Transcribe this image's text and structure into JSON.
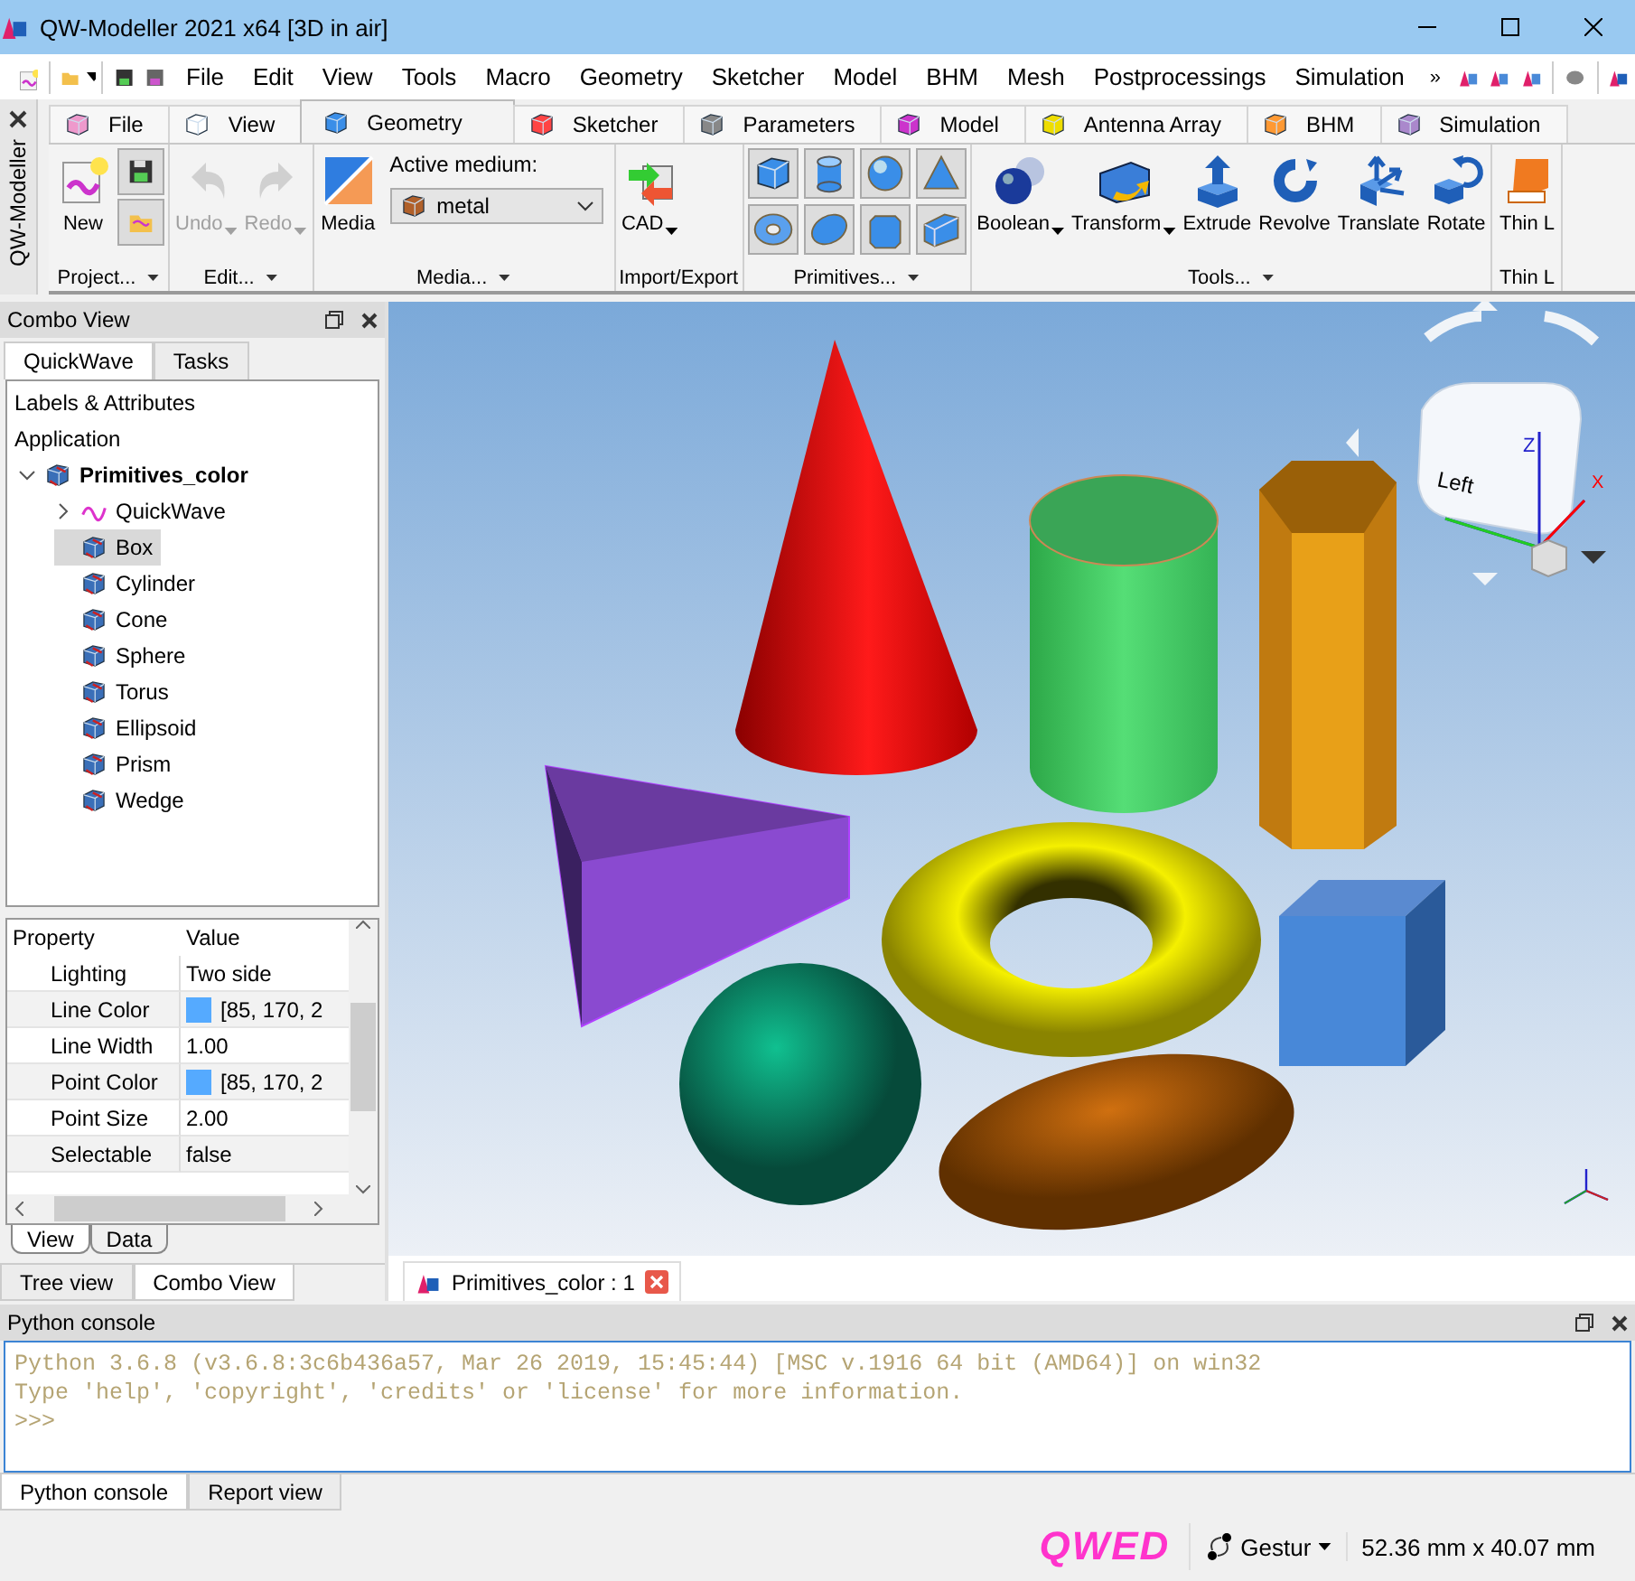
{
  "window": {
    "title": "QW-Modeller 2021 x64 [3D in air]"
  },
  "menu": [
    {
      "label": "File"
    },
    {
      "label": "Edit"
    },
    {
      "label": "View"
    },
    {
      "label": "Tools"
    },
    {
      "label": "Macro"
    },
    {
      "label": "Geometry"
    },
    {
      "label": "Sketcher"
    },
    {
      "label": "Model"
    },
    {
      "label": "BHM"
    },
    {
      "label": "Mesh"
    },
    {
      "label": "Postprocessings"
    },
    {
      "label": "Simulation"
    }
  ],
  "menu_overflow": "»",
  "side_strip": {
    "title": "QW-Modeller"
  },
  "ribbon_tabs": [
    {
      "label": "File",
      "selected": false
    },
    {
      "label": "View",
      "selected": false
    },
    {
      "label": "Geometry",
      "selected": true
    },
    {
      "label": "Sketcher",
      "selected": false
    },
    {
      "label": "Parameters",
      "selected": false
    },
    {
      "label": "Model",
      "selected": false
    },
    {
      "label": "Antenna Array",
      "selected": false
    },
    {
      "label": "BHM",
      "selected": false
    },
    {
      "label": "Simulation",
      "selected": false
    }
  ],
  "ribbon_groups": [
    {
      "title": "Project...",
      "launcher": true,
      "buttons": [
        {
          "kind": "large",
          "label": "New",
          "disabled": false,
          "menu": false
        },
        {
          "kind": "stack"
        }
      ]
    },
    {
      "title": "Edit...",
      "launcher": true,
      "buttons": [
        {
          "kind": "large",
          "label": "Undo",
          "disabled": true,
          "menu": true
        },
        {
          "kind": "large",
          "label": "Redo",
          "disabled": true,
          "menu": true
        }
      ]
    },
    {
      "title": "Media...",
      "launcher": true,
      "buttons": [
        {
          "kind": "large",
          "label": "Media",
          "disabled": false,
          "menu": false
        },
        {
          "kind": "field",
          "caption": "Active medium:",
          "value": "metal"
        }
      ]
    },
    {
      "title": "Import/Export",
      "launcher": false,
      "buttons": [
        {
          "kind": "large",
          "label": "CAD",
          "disabled": false,
          "menu": true
        }
      ]
    },
    {
      "title": "Primitives...",
      "launcher": true,
      "buttons": [
        {
          "kind": "grid"
        }
      ]
    },
    {
      "title": "Tools...",
      "launcher": true,
      "buttons": [
        {
          "kind": "large",
          "label": "Boolean",
          "disabled": false,
          "menu": true
        },
        {
          "kind": "large",
          "label": "Transform",
          "disabled": false,
          "menu": true
        },
        {
          "kind": "large",
          "label": "Extrude",
          "disabled": false,
          "menu": false
        },
        {
          "kind": "large",
          "label": "Revolve",
          "disabled": false,
          "menu": false
        },
        {
          "kind": "large",
          "label": "Translate",
          "disabled": false,
          "menu": false
        },
        {
          "kind": "large",
          "label": "Rotate",
          "disabled": false,
          "menu": false
        }
      ]
    },
    {
      "title": "Thin L",
      "launcher": false,
      "buttons": [
        {
          "kind": "large",
          "label": "Thin L",
          "disabled": false,
          "menu": false
        }
      ]
    }
  ],
  "combo_view": {
    "title": "Combo View",
    "tabs": [
      {
        "label": "QuickWave",
        "selected": true
      },
      {
        "label": "Tasks",
        "selected": false
      }
    ]
  },
  "tree": {
    "header": "Labels & Attributes",
    "root_label": "Application",
    "items": [
      {
        "label": "Primitives_color",
        "expanded": true,
        "selected": false,
        "children": [
          {
            "label": "QuickWave",
            "expanded": false,
            "selected": false
          },
          {
            "label": "Box",
            "selected": true
          },
          {
            "label": "Cylinder",
            "selected": false
          },
          {
            "label": "Cone",
            "selected": false
          },
          {
            "label": "Sphere",
            "selected": false
          },
          {
            "label": "Torus",
            "selected": false
          },
          {
            "label": "Ellipsoid",
            "selected": false
          },
          {
            "label": "Prism",
            "selected": false
          },
          {
            "label": "Wedge",
            "selected": false
          }
        ]
      }
    ]
  },
  "properties": {
    "columns": [
      "Property",
      "Value"
    ],
    "rows": [
      {
        "name": "Lighting",
        "value": "Two side"
      },
      {
        "name": "Line Color",
        "value": "[85, 170, 2",
        "color": "#55aaff"
      },
      {
        "name": "Line Width",
        "value": "1.00"
      },
      {
        "name": "Point Color",
        "value": "[85, 170, 2",
        "color": "#55aaff"
      },
      {
        "name": "Point Size",
        "value": "2.00"
      },
      {
        "name": "Selectable",
        "value": "false"
      }
    ],
    "tabs": [
      {
        "label": "View",
        "selected": true
      },
      {
        "label": "Data",
        "selected": false
      }
    ]
  },
  "panel_tabs": [
    {
      "label": "Tree view",
      "selected": false
    },
    {
      "label": "Combo View",
      "selected": true
    }
  ],
  "viewport": {
    "nav_cube": {
      "face": "Left",
      "axes": [
        "Z",
        "X"
      ]
    }
  },
  "document_tabs": [
    {
      "label": "Primitives_color : 1",
      "selected": true
    }
  ],
  "console": {
    "title": "Python console",
    "lines": [
      "Python 3.6.8 (v3.6.8:3c6b436a57, Mar 26 2019, 15:45:44) [MSC v.1916 64 bit (AMD64)] on win32",
      "Type 'help', 'copyright', 'credits' or 'license' for more information.",
      ">>>"
    ]
  },
  "bottom_tabs": [
    {
      "label": "Python console",
      "selected": true
    },
    {
      "label": "Report view",
      "selected": false
    }
  ],
  "status_bar": {
    "logo": "QWED",
    "navigation": "Gestur",
    "dimensions": "52.36 mm x 40.07 mm"
  }
}
